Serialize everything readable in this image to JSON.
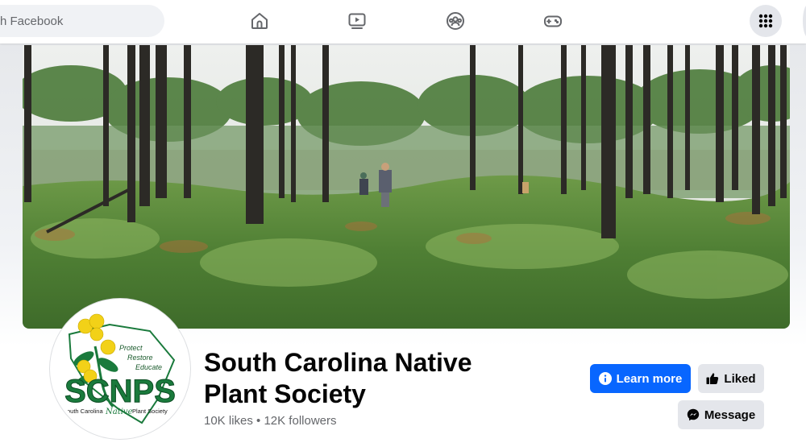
{
  "topbar": {
    "search_placeholder": "Search Facebook",
    "search_visible_text": "h Facebook",
    "nav_icons": [
      "home-icon",
      "watch-icon",
      "groups-icon",
      "gaming-icon"
    ],
    "menu_icon": "apps-grid-icon"
  },
  "cover": {
    "description_icon": "cover-photo"
  },
  "avatar_logo": {
    "tagline": [
      "Protect",
      "Restore",
      "Educate"
    ],
    "acronym": "SCNPS",
    "subtitle_left": "South Carolina",
    "subtitle_script": "Native",
    "subtitle_right": "Plant Society"
  },
  "page": {
    "name_line1": "South Carolina Native",
    "name_line2": "Plant Society",
    "stats": "10K likes • 12K followers"
  },
  "actions": {
    "learn_more": "Learn more",
    "liked": "Liked",
    "message": "Message"
  },
  "colors": {
    "primary": "#0866ff",
    "secondary_btn": "#e4e6eb",
    "logo_green": "#1a7a3c",
    "logo_yellow": "#f2d118"
  }
}
